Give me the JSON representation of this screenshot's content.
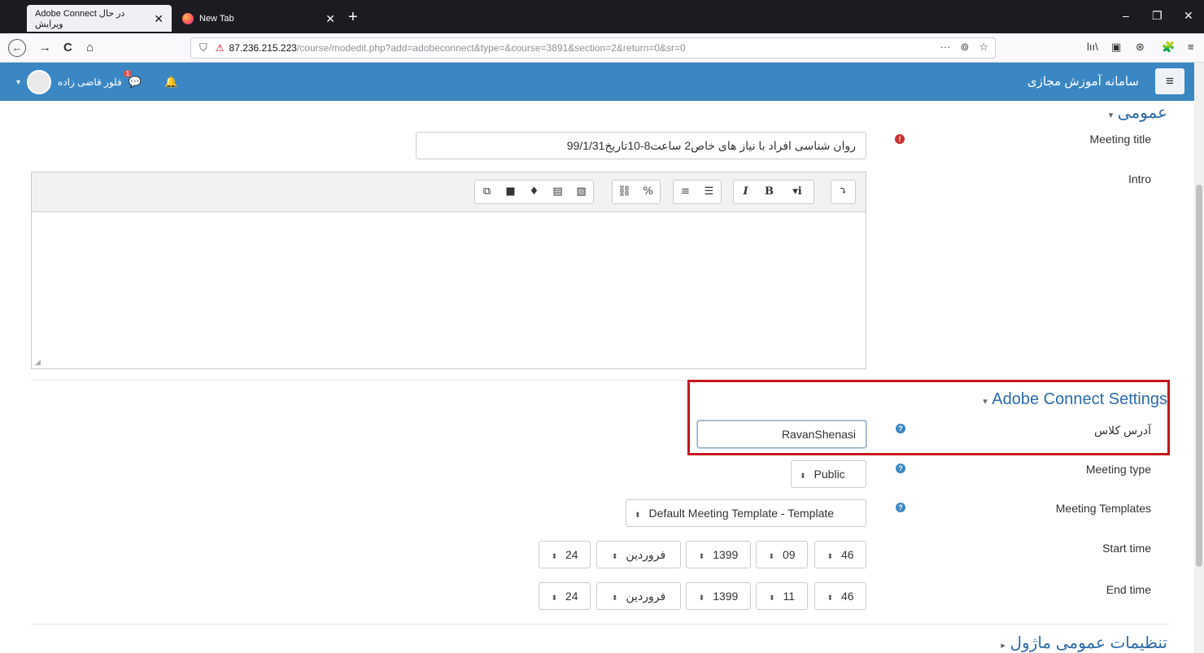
{
  "browser": {
    "tabs": [
      {
        "title": "Adobe Connect در حال ویرایش",
        "close": "✕"
      },
      {
        "title": "New Tab",
        "close": "✕"
      }
    ],
    "new_tab": "+",
    "window_controls": {
      "minimize": "–",
      "maximize": "❐",
      "close": "✕"
    },
    "nav": {
      "back": "←",
      "forward": "→",
      "reload": "C",
      "home": "⌂"
    },
    "url_host": "87.236.215.223",
    "url_path": "/course/modedit.php?add=adobeconnect&type=&course=3891&section=2&return=0&sr=0",
    "url_actions": {
      "more": "···",
      "pocket": "⊚",
      "bookmark": "☆"
    },
    "toolbar_right": {
      "library": "lıı\\",
      "sidebar": "▣",
      "account": "⊛",
      "extensions": "🧩",
      "menu": "≡"
    }
  },
  "header": {
    "menu_icon": "≡",
    "site_name": "سامانه آموزش مجازی",
    "user_name": "فلور قاضی زاده",
    "user_caret": "▾",
    "message_badge": "1",
    "message_icon": "💬",
    "bell_icon": "🔔"
  },
  "form": {
    "general_section": "عمومی",
    "general_toggle": "▾",
    "meeting_title_label": "Meeting title",
    "meeting_title_value": "روان شناسی افراد با نیاز های خاص2 ساعت8-10تاریخ99/1/31",
    "intro_label": "Intro",
    "editor_buttons": {
      "g1": [
        "⧉",
        "■",
        "♦",
        "▤",
        "▨"
      ],
      "g2": [
        "⛓",
        "%"
      ],
      "g3": [
        "≡",
        "☰"
      ],
      "g4": [
        "I",
        "B",
        "▾i"
      ],
      "g5": [
        "⤵"
      ]
    },
    "adobe_section": "Adobe Connect Settings",
    "adobe_toggle": "▾",
    "class_address_label": "آدرس کلاس",
    "class_address_value": "RavanShenasi",
    "meeting_type_label": "Meeting type",
    "meeting_type_value": "Public",
    "meeting_templates_label": "Meeting Templates",
    "meeting_templates_value": "Default Meeting Template - Template",
    "start_time_label": "Start time",
    "start_time": {
      "day": "24",
      "month": "فروردین",
      "year": "1399",
      "hour": "09",
      "minute": "46"
    },
    "end_time_label": "End time",
    "end_time": {
      "day": "24",
      "month": "فروردین",
      "year": "1399",
      "hour": "11",
      "minute": "46"
    },
    "module_section": "تنظیمات عمومی ماژول",
    "module_toggle": "▸",
    "select_arrow": "⬍",
    "required_icon": "!",
    "help_icon": "?"
  },
  "colors": {
    "moodle_header": "#3a87c3",
    "section_title": "#2a6aa8",
    "highlight_border": "#c4161c",
    "browser_tabbar": "#1c1b22"
  }
}
